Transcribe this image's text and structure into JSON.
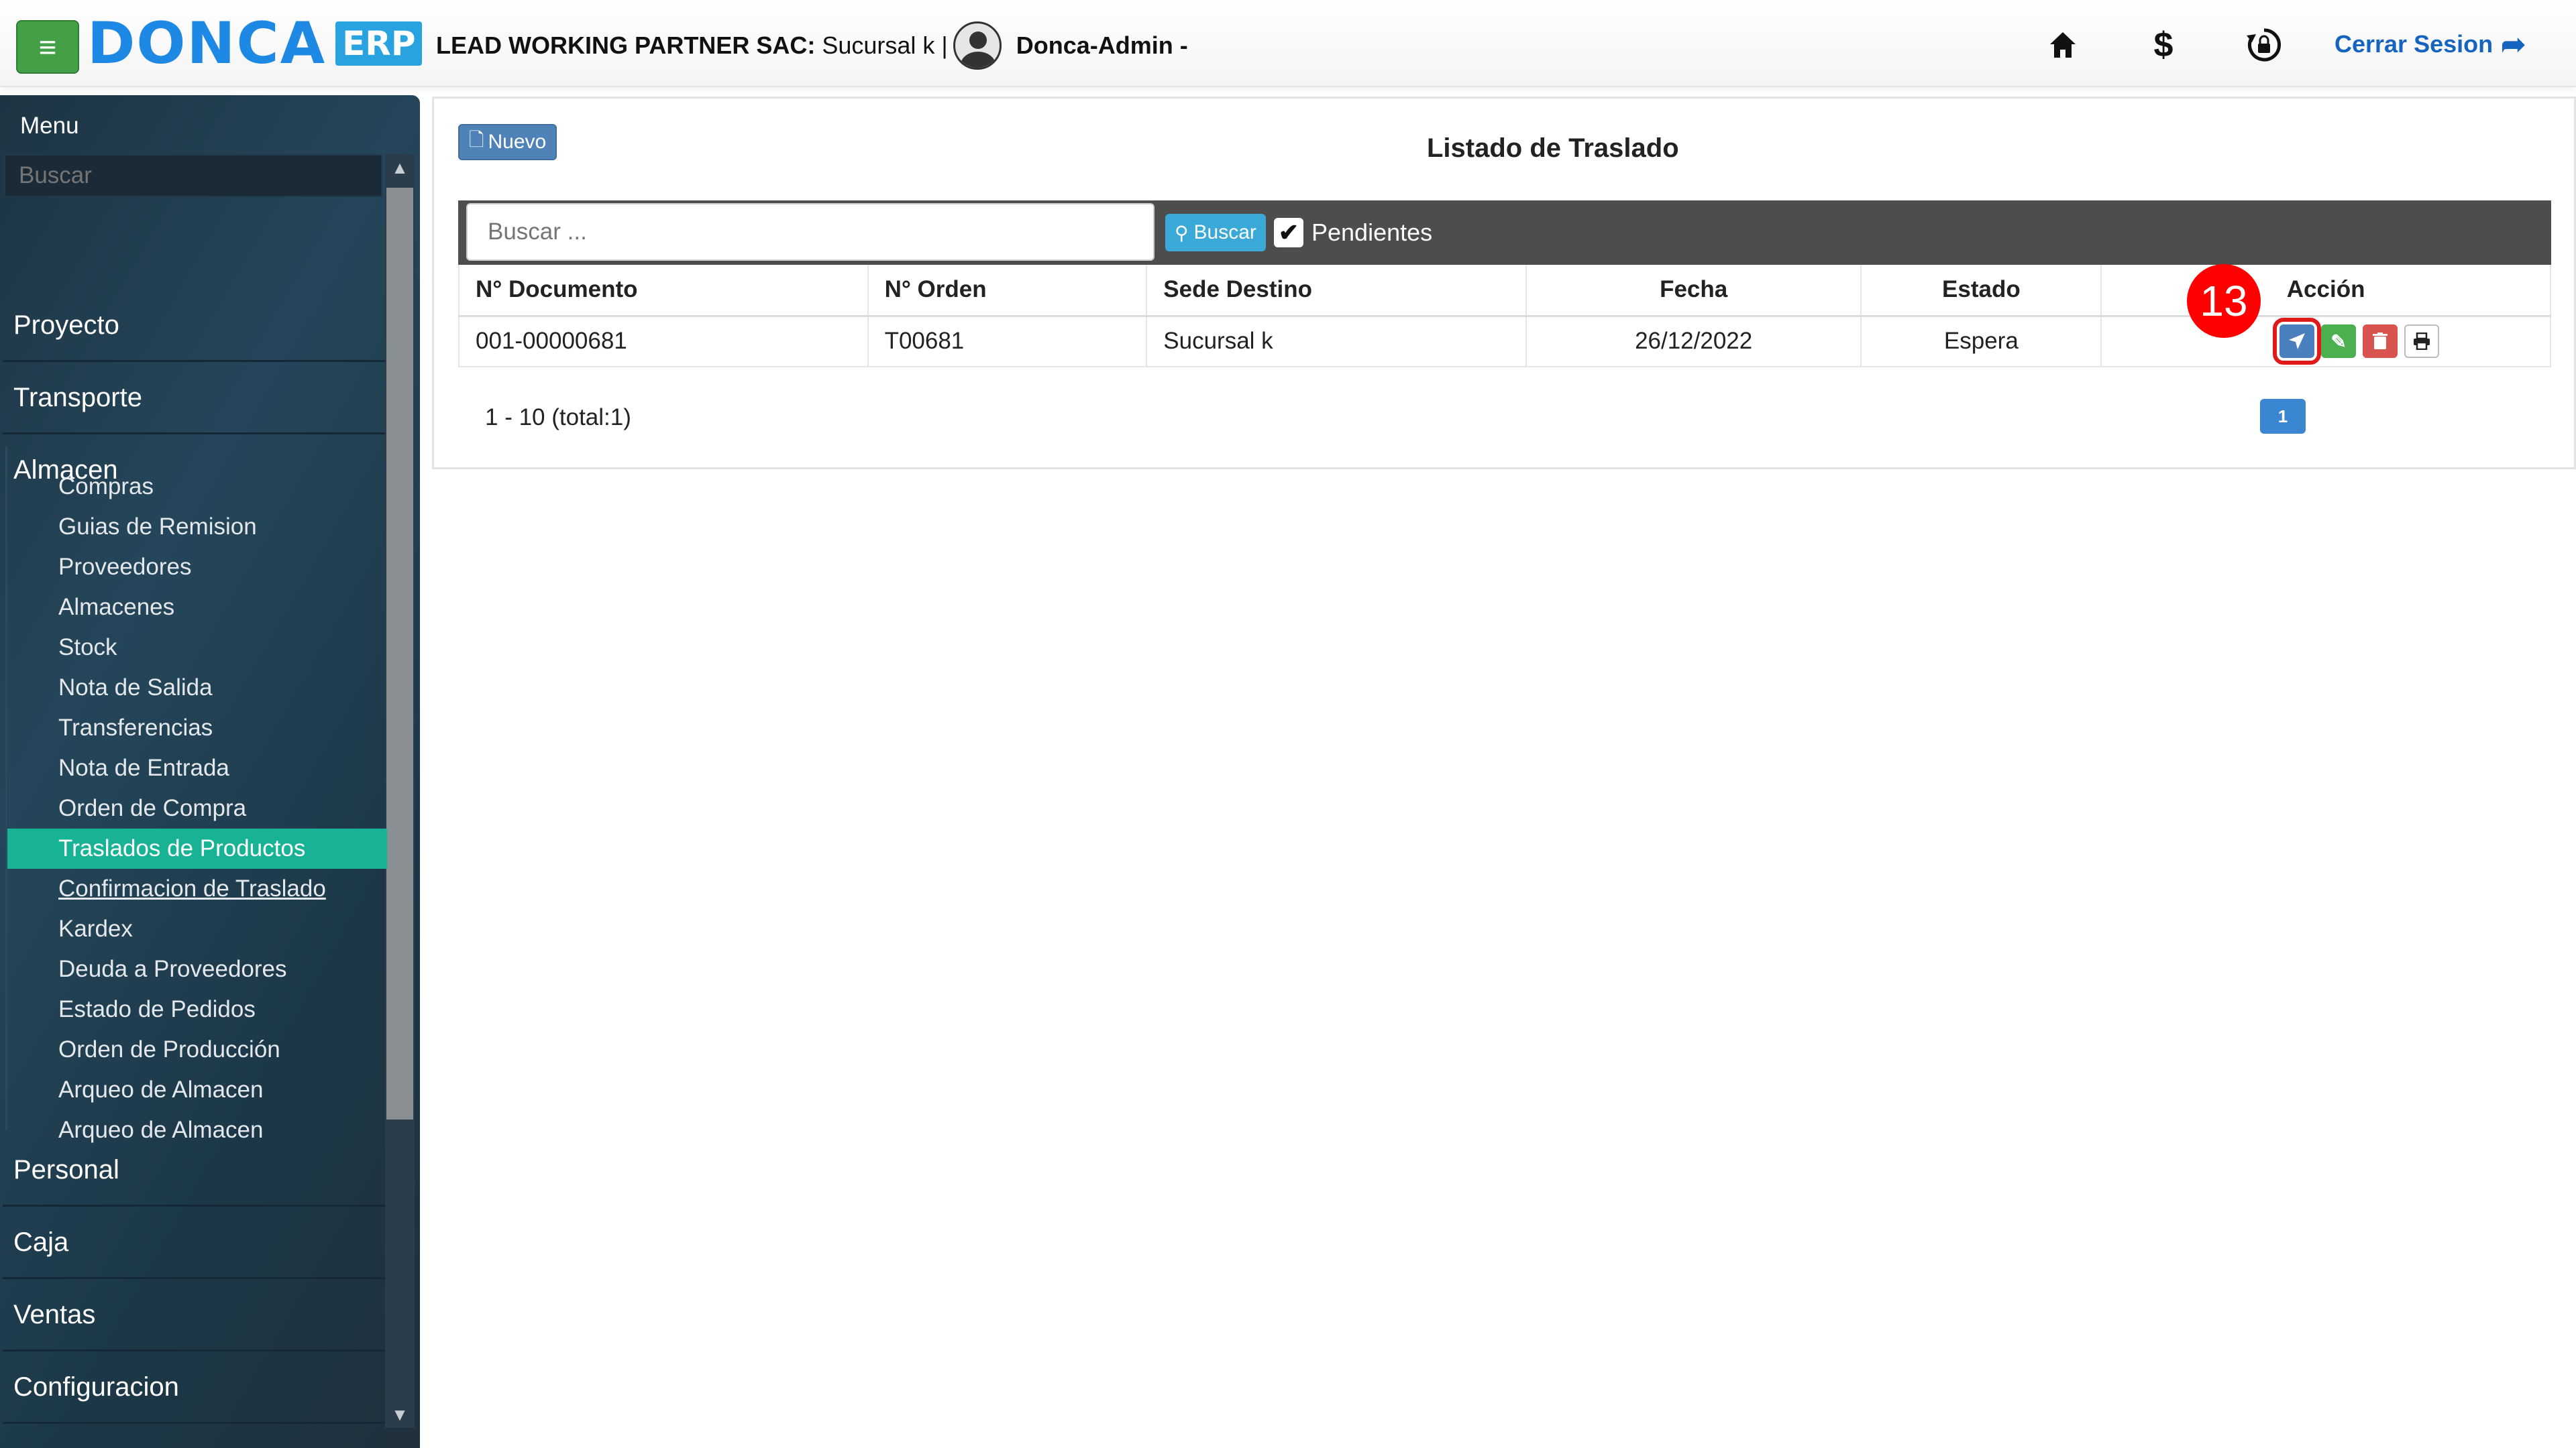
{
  "header": {
    "logo_text": "DONCA",
    "logo_badge": "ERP",
    "company_name": "LEAD WORKING PARTNER SAC:",
    "branch": " Sucursal k |",
    "user": "Donca-Admin -",
    "icons": [
      "home-icon",
      "dollar-icon",
      "lock-rotate-icon"
    ],
    "logout_label": "Cerrar Sesion"
  },
  "sidebar": {
    "title": "Menu",
    "search_placeholder": "Buscar",
    "sections_top": [
      {
        "label": "Proyecto"
      },
      {
        "label": "Transporte"
      },
      {
        "label": "Almacen"
      }
    ],
    "almacen_items": [
      {
        "label": "Compras"
      },
      {
        "label": "Guias de Remision"
      },
      {
        "label": "Proveedores"
      },
      {
        "label": "Almacenes"
      },
      {
        "label": "Stock"
      },
      {
        "label": "Nota de Salida"
      },
      {
        "label": "Transferencias"
      },
      {
        "label": "Nota de Entrada"
      },
      {
        "label": "Orden de Compra"
      },
      {
        "label": "Traslados de Productos"
      },
      {
        "label": "Confirmacion de Traslado"
      },
      {
        "label": "Kardex"
      },
      {
        "label": "Deuda a Proveedores"
      },
      {
        "label": "Estado de Pedidos"
      },
      {
        "label": "Orden de Producción"
      },
      {
        "label": "Arqueo de Almacen"
      },
      {
        "label": "Arqueo de Almacen"
      }
    ],
    "active_item": "Traslados de Productos",
    "sections_bottom": [
      {
        "label": "Personal"
      },
      {
        "label": "Caja"
      },
      {
        "label": "Ventas"
      },
      {
        "label": "Configuracion"
      }
    ]
  },
  "main": {
    "new_button": "Nuevo",
    "title": "Listado de Traslado",
    "search_placeholder": "Buscar ...",
    "search_button": "Buscar",
    "pending_label": "Pendientes",
    "pending_checked": true,
    "columns": [
      "N° Documento",
      "N° Orden",
      "Sede Destino",
      "Fecha",
      "Estado",
      "Acción"
    ],
    "rows": [
      {
        "documento": "001-00000681",
        "orden": "T00681",
        "sede": "Sucursal k",
        "fecha": "26/12/2022",
        "estado": "Espera"
      }
    ],
    "row_actions": [
      "send-icon",
      "edit-icon",
      "trash-icon",
      "print-icon"
    ],
    "pagination_info": "1 - 10 (total:1)",
    "current_page": "1",
    "step_badge": "13"
  },
  "colors": {
    "accent": "#17b394",
    "menu_toggle": "#43a047",
    "primary": "#4a7fbe",
    "highlight": "#e11919"
  }
}
